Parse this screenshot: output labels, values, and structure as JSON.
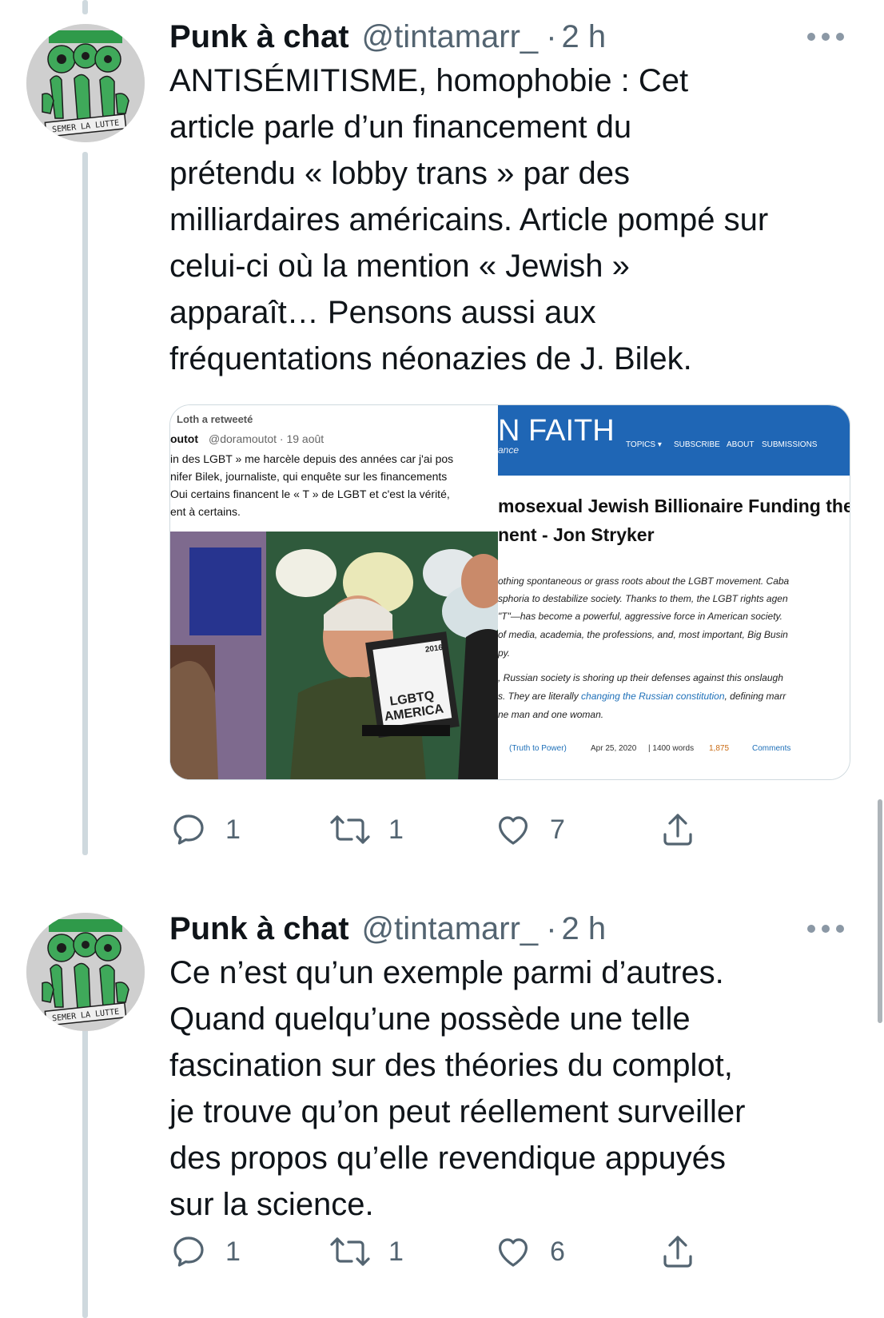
{
  "tweets": [
    {
      "name": "Punk à chat",
      "handle": "@tintamarr_",
      "dot": "·",
      "time": "2 h",
      "avatar_text": [
        "SEMER LA LUTTE"
      ],
      "text_lines": [
        "ANTISÉMITISME, homophobie : Cet",
        "article parle d’un financement du",
        "prétendu « lobby trans » par des",
        "milliardaires américains. Article pompé sur",
        "celui-ci où la mention « Jewish »",
        "apparaît… Pensons aussi aux",
        "fréquentations néonazies de J. Bilek."
      ],
      "media": {
        "left": {
          "retweet_label": "Loth a retweeté",
          "author": "outot",
          "author_handle": "@doramoutot · 19 août",
          "text_lines": [
            "in des LGBT » me harcèle depuis des années car j'ai pos",
            "nifer Bilek, journaliste, qui enquête sur les financements",
            "Oui certains financent le « T » de LGBT et c'est la vérité,",
            "ent à certains."
          ],
          "photo_sign_line1": "LGBTQ",
          "photo_sign_line2": "AMERICA",
          "photo_year": "2016"
        },
        "right": {
          "site_title": "N FAITH",
          "site_subtitle": "ance",
          "nav": [
            "TOPICS ▾",
            "SUBSCRIBE",
            "ABOUT",
            "SUBMISSIONS"
          ],
          "headline_lines": [
            "mosexual Jewish Billionaire Funding the LG",
            "nent - Jon Stryker"
          ],
          "paragraph1": [
            "othing spontaneous or grass roots about the LGBT movement. Caba",
            "sphoria to destabilize society. Thanks to them, the LGBT rights agen",
            "\"T\"—has become a powerful, aggressive force in American society.",
            "of media, academia, the professions, and, most important, Big Busin",
            "py."
          ],
          "paragraph2_prefix": ", Russian society is shoring up their defenses against this onslaugh",
          "paragraph2_line2_before": "s. They are literally ",
          "paragraph2_link": "changing the Russian constitution",
          "paragraph2_line2_after": ", defining marr",
          "paragraph2_line3": "ne man and one woman.",
          "meta": {
            "category": "(Truth to Power)",
            "date": "Apr 25, 2020",
            "words": "| 1400 words",
            "likes": "1,875",
            "comments": "Comments"
          }
        }
      },
      "actions": {
        "replies": "1",
        "retweets": "1",
        "likes": "7"
      }
    },
    {
      "name": "Punk à chat",
      "handle": "@tintamarr_",
      "dot": "·",
      "time": "2 h",
      "avatar_text": [
        "SEMER LA LUTTE"
      ],
      "text_lines": [
        "Ce n’est qu’un exemple parmi d’autres.",
        "Quand quelqu’une possède une telle",
        "fascination sur des théories du complot,",
        "je trouve qu’on peut réellement surveiller",
        "des propos qu’elle revendique appuyés",
        "sur la science."
      ],
      "actions": {
        "replies": "1",
        "retweets": "1",
        "likes": "6"
      }
    }
  ],
  "colors": {
    "text": "#0f1419",
    "secondary": "#536471",
    "thread_line": "#cfd9de",
    "link": "#1d6fb8",
    "site_header": "#1f66b5"
  },
  "icons": [
    "reply-icon",
    "retweet-icon",
    "like-icon",
    "share-icon",
    "more-icon"
  ]
}
